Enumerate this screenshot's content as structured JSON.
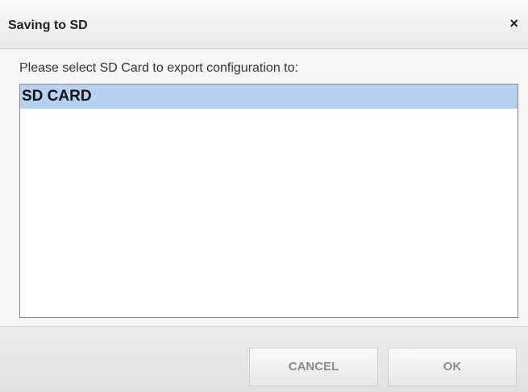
{
  "dialog": {
    "title": "Saving to SD",
    "close_label": "×"
  },
  "body": {
    "prompt": "Please select SD Card to export configuration to:",
    "list": {
      "items": [
        {
          "label": "SD CARD",
          "selected": true
        }
      ]
    }
  },
  "footer": {
    "cancel_label": "CANCEL",
    "ok_label": "OK"
  },
  "colors": {
    "selection": "#b9d1f1",
    "button_text": "#8a8a8a"
  }
}
